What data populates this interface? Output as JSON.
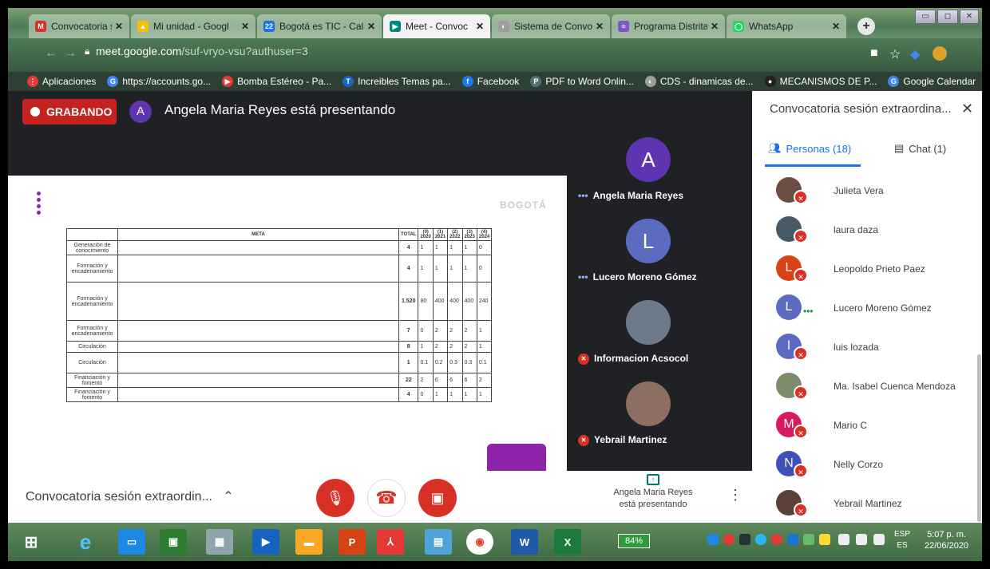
{
  "tabs": [
    {
      "label": "Convocatoria sesió",
      "icon": "gmail-icon",
      "color": "#d93025",
      "glyph": "M"
    },
    {
      "label": "Mi unidad - Googl",
      "icon": "drive-icon",
      "color": "#fbbc04",
      "glyph": "▲"
    },
    {
      "label": "Bogotá es TIC - Cal",
      "icon": "calendar-icon",
      "color": "#1a73e8",
      "glyph": "22"
    },
    {
      "label": "Meet - Convoc",
      "icon": "meet-icon",
      "color": "#00897b",
      "glyph": "▶"
    },
    {
      "label": "Sistema de Convoc",
      "icon": "system-icon",
      "color": "#9e9e9e",
      "glyph": "◐"
    },
    {
      "label": "Programa Distrital",
      "icon": "program-icon",
      "color": "#7e57c2",
      "glyph": "≡"
    },
    {
      "label": "WhatsApp",
      "icon": "whatsapp-icon",
      "color": "#25d366",
      "glyph": "◯"
    }
  ],
  "address": {
    "host": "meet.google.com",
    "path": "/suf-vryo-vsu?authuser=3"
  },
  "bookmarks": [
    {
      "label": "Aplicaciones",
      "color": "#e53935",
      "glyph": "⋮"
    },
    {
      "label": "https://accounts.go...",
      "color": "#4285f4",
      "glyph": "G"
    },
    {
      "label": "Bomba Estéreo - Pa...",
      "color": "#e53935",
      "glyph": "▶"
    },
    {
      "label": "Increibles Temas pa...",
      "color": "#1565c0",
      "glyph": "T"
    },
    {
      "label": "Facebook",
      "color": "#1877f2",
      "glyph": "f"
    },
    {
      "label": "PDF to Word Onlin...",
      "color": "#546e7a",
      "glyph": "P"
    },
    {
      "label": "CDS - dinamicas de...",
      "color": "#9e9e9e",
      "glyph": "◐"
    },
    {
      "label": "MECANISMOS DE P...",
      "color": "#212121",
      "glyph": "●"
    },
    {
      "label": "Google Calendar",
      "color": "#4285f4",
      "glyph": "G"
    }
  ],
  "meet": {
    "recording_label": "GRABANDO",
    "presenter_initial": "A",
    "presenting_text": "Angela Maria Reyes está presentando",
    "slide_logo": "BOGOTÁ",
    "table": {
      "headers": [
        "",
        "META",
        "TOTAL",
        "(0) 2020",
        "(1) 2021",
        "(2) 2022",
        "(3) 2023",
        "(4) 2024"
      ],
      "rows": [
        {
          "cat": "Generación de conocimiento",
          "meta": "Desarrollar 4 documentos de caracterización de las dinámicas de oferta y demanda del ecosistema creativo del centro",
          "total": "4",
          "v": [
            "1",
            "1",
            "1",
            "1",
            "0"
          ]
        },
        {
          "cat": "Formación y encadenamiento",
          "meta": "Apoyar técnicamente el desarrollo de 4 procesos locales en la economía cultural y creativa del centro y su articulación con otros sectores",
          "total": "4",
          "v": [
            "1",
            "1",
            "1",
            "1",
            "0"
          ]
        },
        {
          "cat": "Formación y encadenamiento",
          "meta": "Generar procesos de formación a 1.520 personas en competencias personales y empresariales de iniciativas de la economía cultural y creativa del centro, se atenderá proyectos de emprendimiento de jóvenes, mujeres y grupos étnicos.",
          "total": "1.520",
          "v": [
            "80",
            "400",
            "400",
            "400",
            "240"
          ]
        },
        {
          "cat": "Formación y encadenamiento",
          "meta": "Desarrollar 7 laboratorios de co-creación y otros procesos de cualificación de productos del ecosistema cultural y creativo del centro",
          "total": "7",
          "v": [
            "0",
            "2",
            "2",
            "2",
            "1"
          ]
        },
        {
          "cat": "Circulación",
          "meta": "Apoyar la realización de 8 mercados o la participación de agentes en espacios de circulación o promoción.",
          "total": "8",
          "v": [
            "1",
            "2",
            "2",
            "2",
            "1"
          ]
        },
        {
          "cat": "Circulación",
          "meta": "Diseñar y poner en marcha 1 plataforma digital que facilite la circulación y consumo de los bienes, contenidos y servicios ofertados por los actores culturales y creativos del centro.",
          "total": "1",
          "v": [
            "0.1",
            "0.2",
            "0.3",
            "0.3",
            "0.1"
          ]
        },
        {
          "cat": "Financiación y fomento",
          "meta": "Otorgar 22 incentivos económicos a agentes del ecosistema de la economía creativa del centro.",
          "total": "22",
          "v": [
            "2",
            "6",
            "6",
            "6",
            "2"
          ]
        },
        {
          "cat": "Financiación y fomento",
          "meta": "Realizar 4 procesos de articulación para que los emprendedores puedan acceder a financiación.",
          "total": "4",
          "v": [
            "0",
            "1",
            "1",
            "1",
            "1"
          ]
        }
      ]
    },
    "tiles": [
      {
        "name": "Angela Maria Reyes",
        "initial": "A",
        "color": "#5e35b1",
        "status": "dots"
      },
      {
        "name": "Lucero Moreno Gómez",
        "initial": "L",
        "color": "#5c6bc0",
        "status": "dots"
      },
      {
        "name": "Informacion Acsocol",
        "initial": "",
        "color": "#6d7a8a",
        "status": "muted"
      },
      {
        "name": "Yebrail Martinez",
        "initial": "",
        "color": "#8d6e63",
        "status": "muted"
      }
    ],
    "meeting_title": "Convocatoria sesión extraordin...",
    "presenting_now": "Angela Maria Reyes está presentando"
  },
  "panel": {
    "title": "Convocatoria sesión extraordina...",
    "people_tab": "Personas (18)",
    "chat_tab": "Chat (1)",
    "participants": [
      {
        "name": "Julieta Vera",
        "initial": "",
        "color": "#6d4c41"
      },
      {
        "name": "laura daza",
        "initial": "",
        "color": "#455a64"
      },
      {
        "name": "Leopoldo Prieto Paez",
        "initial": "L",
        "color": "#d84315"
      },
      {
        "name": "Lucero Moreno Gómez",
        "initial": "L",
        "color": "#5c6bc0"
      },
      {
        "name": "luis lozada",
        "initial": "l",
        "color": "#5c6bc0"
      },
      {
        "name": "Ma. Isabel Cuenca Mendoza",
        "initial": "",
        "color": "#7c8b6a"
      },
      {
        "name": "Mario C",
        "initial": "M",
        "color": "#d81b60"
      },
      {
        "name": "Nelly Corzo",
        "initial": "N",
        "color": "#3f51b5"
      },
      {
        "name": "Yebrail Martinez",
        "initial": "",
        "color": "#5d4037"
      }
    ]
  },
  "taskbar": {
    "battery": "84%",
    "lang_top": "ESP",
    "lang_bottom": "ES",
    "time": "5:07 p. m.",
    "date": "22/06/2020"
  }
}
